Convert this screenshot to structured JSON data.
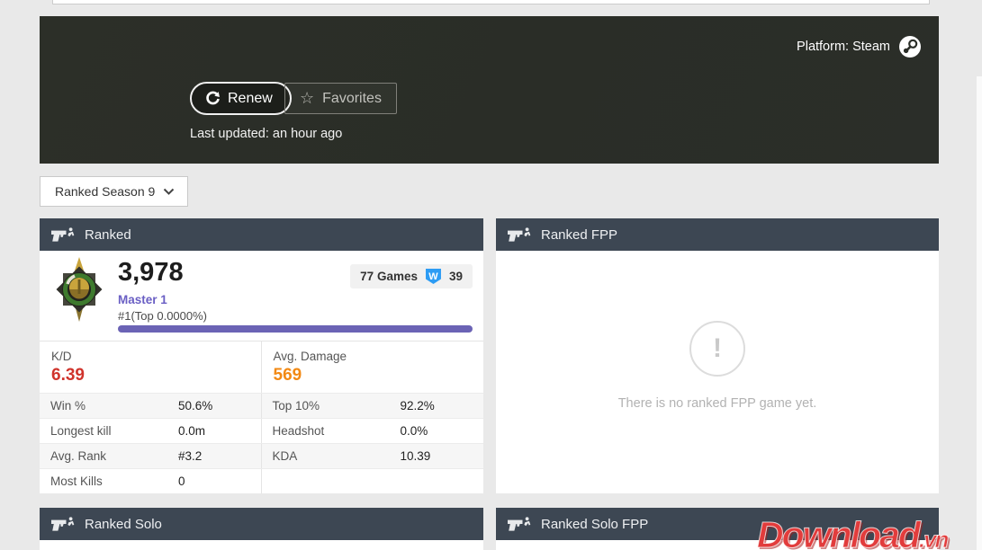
{
  "banner": {
    "platform_label": "Platform: Steam",
    "renew_button": "Renew",
    "favorites_button": "Favorites",
    "favorites_star": "☆",
    "last_updated": "Last updated: an hour ago"
  },
  "season_selector": {
    "selected": "Ranked Season 9"
  },
  "ranked_card": {
    "title": "Ranked",
    "rating_points": "3,978",
    "tier": "Master 1",
    "top_rank": "#1(Top 0.0000%)",
    "games_count": "77 Games",
    "win_badge_letter": "W",
    "win_count": "39",
    "summary": {
      "left_label": "K/D",
      "left_value": "6.39",
      "right_label": "Avg. Damage",
      "right_value": "569"
    },
    "rows": [
      {
        "l_label": "Win %",
        "l_value": "50.6%",
        "r_label": "Top 10%",
        "r_value": "92.2%"
      },
      {
        "l_label": "Longest kill",
        "l_value": "0.0m",
        "r_label": "Headshot",
        "r_value": "0.0%"
      },
      {
        "l_label": "Avg. Rank",
        "l_value": "#3.2",
        "r_label": "KDA",
        "r_value": "10.39"
      },
      {
        "l_label": "Most Kills",
        "l_value": "0",
        "r_label": "",
        "r_value": ""
      }
    ]
  },
  "ranked_fpp_card": {
    "title": "Ranked FPP",
    "empty_icon": "!",
    "empty_message": "There is no ranked FPP game yet."
  },
  "ranked_solo_card": {
    "title": "Ranked Solo"
  },
  "ranked_solo_fpp_card": {
    "title": "Ranked Solo FPP"
  },
  "watermark": {
    "text": "Download",
    "suffix": ".vn"
  },
  "colors": {
    "page_bg": "#e9e9e9",
    "banner_bg": "#2b2e28",
    "card_header_bg": "#3d4753",
    "accent_purple": "#6b63b5",
    "tier_purple": "#6a5fc4",
    "kd_red": "#d0342c",
    "damage_orange": "#f28914",
    "win_badge_blue": "#2d9cf4"
  }
}
